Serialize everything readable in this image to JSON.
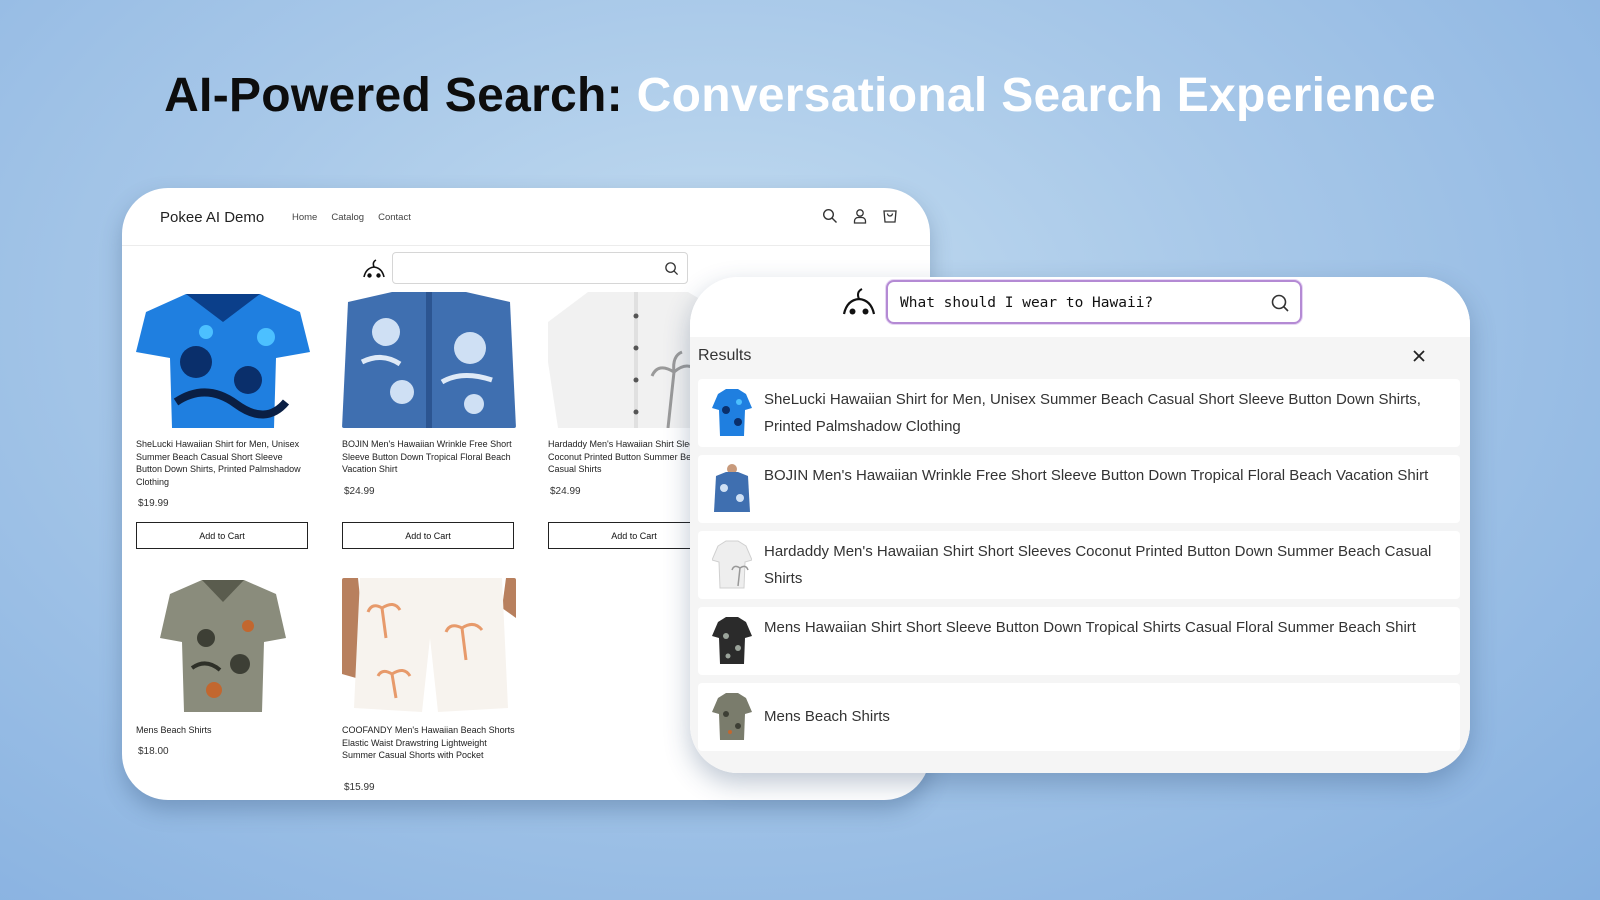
{
  "headline": {
    "part1": "AI-Powered Search:",
    "part2": "Conversational Search Experience"
  },
  "store": {
    "title": "Pokee AI Demo",
    "nav": [
      "Home",
      "Catalog",
      "Contact"
    ],
    "header_icons": [
      "search-icon",
      "account-icon",
      "cart-icon"
    ],
    "search": {
      "placeholder": ""
    },
    "add_to_cart_label": "Add to Cart",
    "products": [
      {
        "name": "SheLucki Hawaiian Shirt for Men, Unisex Summer Beach Casual Short Sleeve Button Down Shirts, Printed Palmshadow Clothing",
        "price": "$19.99",
        "image": "blue-palm-shirt",
        "has_cart_button": true
      },
      {
        "name": "BOJIN Men's Hawaiian Wrinkle Free Short Sleeve Button Down Tropical Floral Beach Vacation Shirt",
        "price": "$24.99",
        "image": "blue-floral-shirt",
        "has_cart_button": true
      },
      {
        "name": "Hardaddy Men's Hawaiian Shirt Sleeves Coconut Printed Button Summer Beach Casual Shirts",
        "price": "$24.99",
        "image": "white-coconut-shirt",
        "has_cart_button": true
      },
      {
        "name": "Mens Beach Shirts",
        "price": "$18.00",
        "image": "grey-tropical-shirt",
        "has_cart_button": false
      },
      {
        "name": "COOFANDY Men's Hawaiian Beach Shorts Elastic Waist Drawstring Lightweight Summer Casual Shorts with Pocket",
        "price": "$15.99",
        "image": "white-palm-shorts",
        "has_cart_button": false
      }
    ]
  },
  "assistant": {
    "query": "What should I wear to Hawaii?",
    "results_label": "Results",
    "results": [
      {
        "text": "SheLucki Hawaiian Shirt for Men, Unisex Summer Beach Casual Short Sleeve Button Down Shirts, Printed Palmshadow Clothing",
        "image": "blue-palm-shirt"
      },
      {
        "text": "BOJIN Men's Hawaiian Wrinkle Free Short Sleeve Button Down Tropical Floral Beach Vacation Shirt",
        "image": "blue-floral-shirt"
      },
      {
        "text": "Hardaddy Men's Hawaiian Shirt Short Sleeves Coconut Printed Button Down Summer Beach Casual Shirts",
        "image": "white-coconut-shirt"
      },
      {
        "text": "Mens Hawaiian Shirt Short Sleeve Button Down Tropical Shirts Casual Floral Summer Beach Shirt",
        "image": "black-floral-shirt"
      },
      {
        "text": "Mens Beach Shirts",
        "image": "grey-tropical-shirt"
      }
    ]
  },
  "colors": {
    "accent_border": "#b48ad4",
    "headline_dark": "#0d0d0d",
    "headline_light": "#ffffff"
  }
}
